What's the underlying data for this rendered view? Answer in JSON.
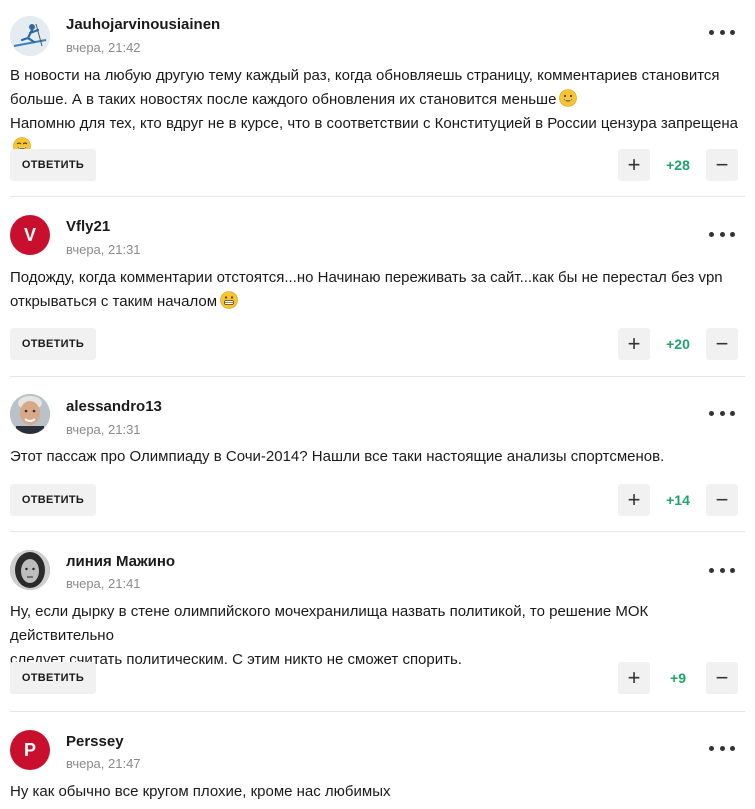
{
  "comments": [
    {
      "author": "Jauhojarvinousiainen",
      "time": "вчера, 21:42",
      "lines": [
        "В новости на любую другую тему каждый раз, когда обновляешь страницу, комментариев становится",
        "больше. А в таких новостях после каждого обновления их становится меньше",
        "Напомню для тех, кто вдруг не в курсе, что в соответствии с Конституцией в России цензура запрещена"
      ],
      "reply_label": "ОТВЕТИТЬ",
      "score": "+28",
      "avatar_icon": "skier-avatar-icon"
    },
    {
      "author": "Vfly21",
      "time": "вчера, 21:31",
      "lines": [
        "Подожду, когда комментарии отстоятся...но Начинаю переживать за сайт...как бы не перестал без vpn",
        "открываться с таким началом"
      ],
      "reply_label": "ОТВЕТИТЬ",
      "score": "+20",
      "avatar_letter": "V",
      "avatar_color": "#c8102e"
    },
    {
      "author": "alessandro13",
      "time": "вчера, 21:31",
      "lines": [
        "Этот пассаж про Олимпиаду в Сочи-2014? Нашли все таки настоящие анализы спортсменов."
      ],
      "reply_label": "ОТВЕТИТЬ",
      "score": "+14",
      "avatar_icon": "man-portrait-avatar-icon"
    },
    {
      "author": "линия Мажино",
      "time": "вчера, 21:41",
      "lines": [
        "Ну, если дырку в стене олимпийского мочехранилища назвать политикой, то решение МОК действительно",
        "следует считать политическим. С этим никто не сможет спорить."
      ],
      "reply_label": "ОТВЕТИТЬ",
      "score": "+9",
      "avatar_icon": "girl-portrait-avatar-icon"
    },
    {
      "author": "Perssey",
      "time": "вчера, 21:47",
      "lines": [
        "Ну как обычно все кругом плохие, кроме нас любимых"
      ],
      "avatar_letter": "P",
      "avatar_color": "#c8102e"
    }
  ],
  "colors": {
    "score_green": "#1ea36b",
    "button_bg": "#f1f1f1",
    "avatar_red": "#c8102e"
  },
  "icons": {
    "more": "more-dots-icon",
    "plus": "plus-icon",
    "minus": "minus-icon",
    "emoji": "grinning-face-emoji-icon"
  }
}
